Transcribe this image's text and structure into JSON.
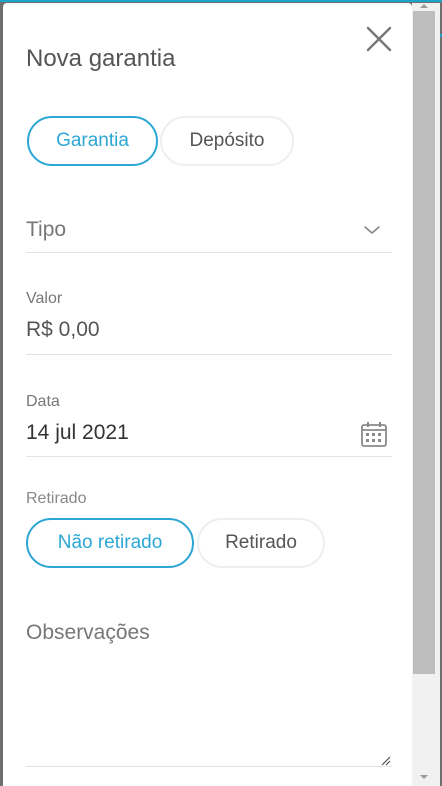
{
  "dialog": {
    "title": "Nova garantia",
    "close_icon": "close-icon"
  },
  "type_toggle": {
    "options": [
      "Garantia",
      "Depósito"
    ],
    "selected": "Garantia"
  },
  "tipo_field": {
    "placeholder": "Tipo",
    "icon": "chevron-down-icon"
  },
  "valor_field": {
    "label": "Valor",
    "value": "R$ 0,00"
  },
  "data_field": {
    "label": "Data",
    "value": "14 jul 2021",
    "icon": "calendar-icon"
  },
  "retirado_field": {
    "label": "Retirado",
    "options": [
      "Não retirado",
      "Retirado"
    ],
    "selected": "Não retirado"
  },
  "observacoes_field": {
    "placeholder": "Observações"
  },
  "colors": {
    "accent": "#2ca7d4",
    "text": "#333333",
    "muted": "#777777",
    "divider": "#e3e3e3",
    "overlay": "#6f6f6f"
  }
}
